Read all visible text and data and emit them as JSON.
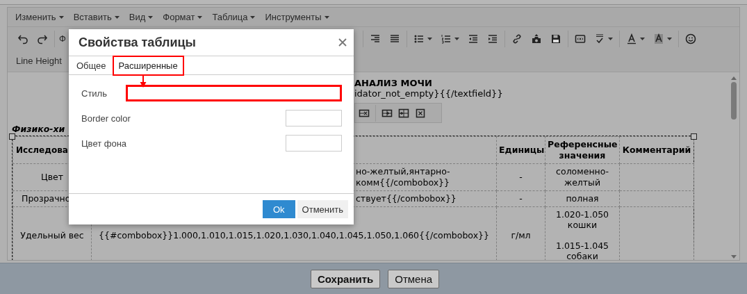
{
  "menubar": [
    "Изменить",
    "Вставить",
    "Вид",
    "Формат",
    "Таблица",
    "Инструменты"
  ],
  "toolbar": {
    "font_select": "Ф",
    "line_height": "Line Height"
  },
  "document": {
    "title": "АНАЛИЗ МОЧИ",
    "template_fragment": "idator_not_empty}{{/textfield}}",
    "section_heading": "Физико-хи",
    "table": {
      "header": {
        "name": "Исследова",
        "units": "Единицы",
        "reference": "Референсные значения",
        "comment": "Комментарий"
      },
      "rows": [
        {
          "name": "Цвет",
          "name_clipped": false,
          "value": "но-желтый,янтарно-\nкомм{{/combobox}}",
          "value_clipped": true,
          "units": "-",
          "reference": "соломенно-\nжелтый"
        },
        {
          "name": "Прозрачно",
          "name_clipped": true,
          "value": "ствует{{/combobox}}",
          "value_clipped": true,
          "units": "-",
          "reference": "полная"
        },
        {
          "name": "Удельный вес",
          "name_clipped": false,
          "value": "{{#combobox}}1.000,1.010,1.015,1.020,1.030,1.040,1.045,1.050,1.060{{/combobox}}",
          "value_clipped": false,
          "units": "г/мл",
          "reference": "1.020-1.050\nкошки\n\n1.015-1.045\nсобаки"
        }
      ]
    }
  },
  "dialog": {
    "title": "Свойства таблицы",
    "tabs": [
      {
        "label": "Общее",
        "selected": false,
        "highlighted": false
      },
      {
        "label": "Расширенные",
        "selected": true,
        "highlighted": true
      }
    ],
    "fields": [
      {
        "label": "Стиль",
        "kind": "wide",
        "highlighted": true
      },
      {
        "label": "Border color",
        "kind": "color",
        "highlighted": false
      },
      {
        "label": "Цвет фона",
        "kind": "color",
        "highlighted": false
      }
    ],
    "buttons": [
      {
        "label": "Ok",
        "kind": "primary"
      },
      {
        "label": "Отменить",
        "kind": "default"
      }
    ]
  },
  "footer_buttons": [
    {
      "label": "Сохранить",
      "kind": "primary"
    },
    {
      "label": "Отмена",
      "kind": "default"
    }
  ]
}
